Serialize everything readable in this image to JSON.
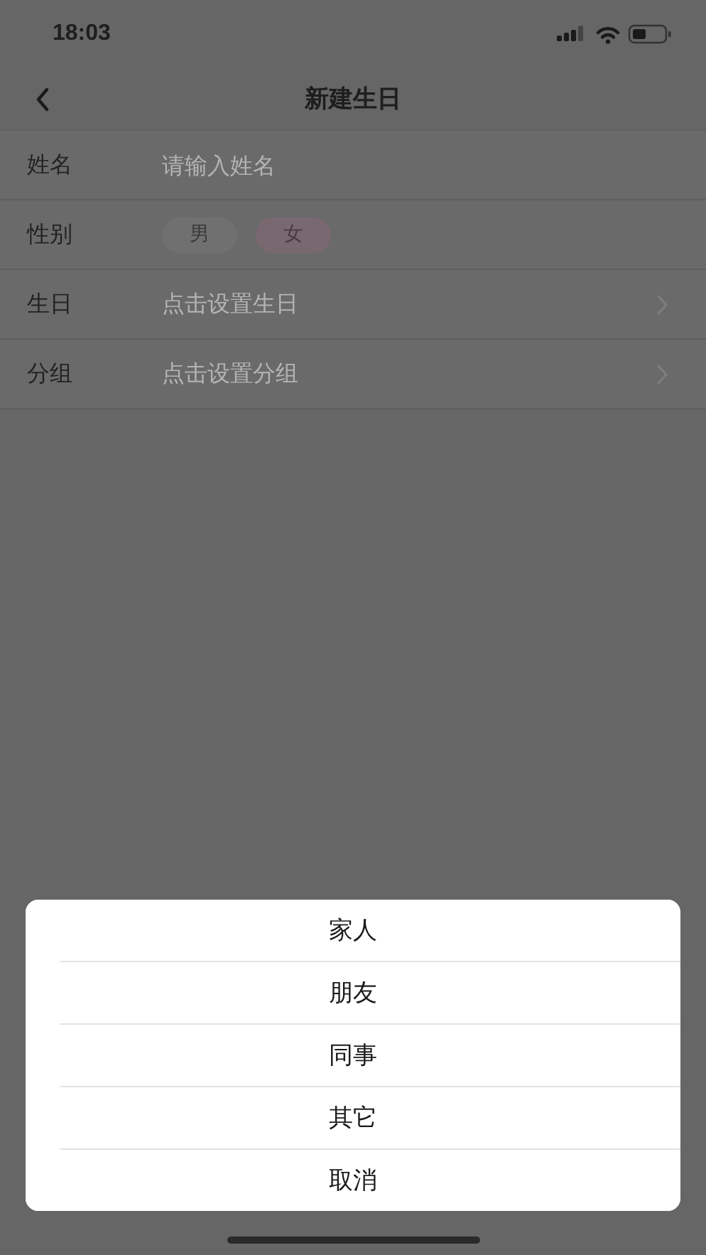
{
  "status_bar": {
    "time": "18:03"
  },
  "nav": {
    "title": "新建生日"
  },
  "form": [
    {
      "kind": "input",
      "label": "姓名",
      "placeholder": "请输入姓名"
    },
    {
      "kind": "choice",
      "label": "性别",
      "options": [
        {
          "label": "男",
          "selected": false
        },
        {
          "label": "女",
          "selected": true
        }
      ]
    },
    {
      "kind": "link",
      "label": "生日",
      "value": "点击设置生日"
    },
    {
      "kind": "link",
      "label": "分组",
      "value": "点击设置分组"
    }
  ],
  "action_sheet": {
    "items": [
      {
        "label": "家人"
      },
      {
        "label": "朋友"
      },
      {
        "label": "同事"
      },
      {
        "label": "其它"
      },
      {
        "label": "取消"
      }
    ]
  }
}
